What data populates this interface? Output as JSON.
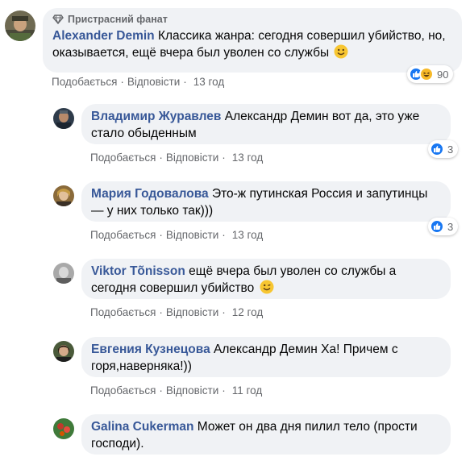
{
  "top_comment": {
    "badge": "Пристрасний фанат",
    "author": "Alexander Demin",
    "text": " Классика жанра: сегодня совершил убийство, но, оказывается, ещё вчера был уволен со службы",
    "actions": {
      "like": "Подобається",
      "reply": "Відповісти",
      "time": "13 год"
    },
    "reaction_count": "90"
  },
  "replies": [
    {
      "author": "Владимир Журавлев",
      "text": " Александр Демин вот да, это уже стало обыденным",
      "actions": {
        "like": "Подобається",
        "reply": "Відповісти",
        "time": "13 год"
      },
      "reaction_count": "3"
    },
    {
      "author": "Мария Годовалова",
      "text": " Это-ж путинская Россия и запутинцы — у них только так)))",
      "actions": {
        "like": "Подобається",
        "reply": "Відповісти",
        "time": "13 год"
      },
      "reaction_count": "3"
    },
    {
      "author": "Viktor Tõnisson",
      "text": " ещё вчера был уволен со службы а сегодня совершил убийство",
      "actions": {
        "like": "Подобається",
        "reply": "Відповісти",
        "time": "12 год"
      }
    },
    {
      "author": "Евгения Кузнецова",
      "text": " Александр Демин Ха! Причем с горя,наверняка!))",
      "actions": {
        "like": "Подобається",
        "reply": "Відповісти",
        "time": "11 год"
      }
    },
    {
      "author": "Galina Cukerman",
      "text": " Может он два дня пилил тело (прости господи)."
    }
  ],
  "colors": {
    "author": "#385898",
    "bubble": "#f0f2f5",
    "meta": "#65676b",
    "like_blue": "#1877f2"
  },
  "icons": [
    "diamond-icon",
    "like-icon",
    "haha-icon",
    "smile-emoji",
    "wink-emoji"
  ]
}
